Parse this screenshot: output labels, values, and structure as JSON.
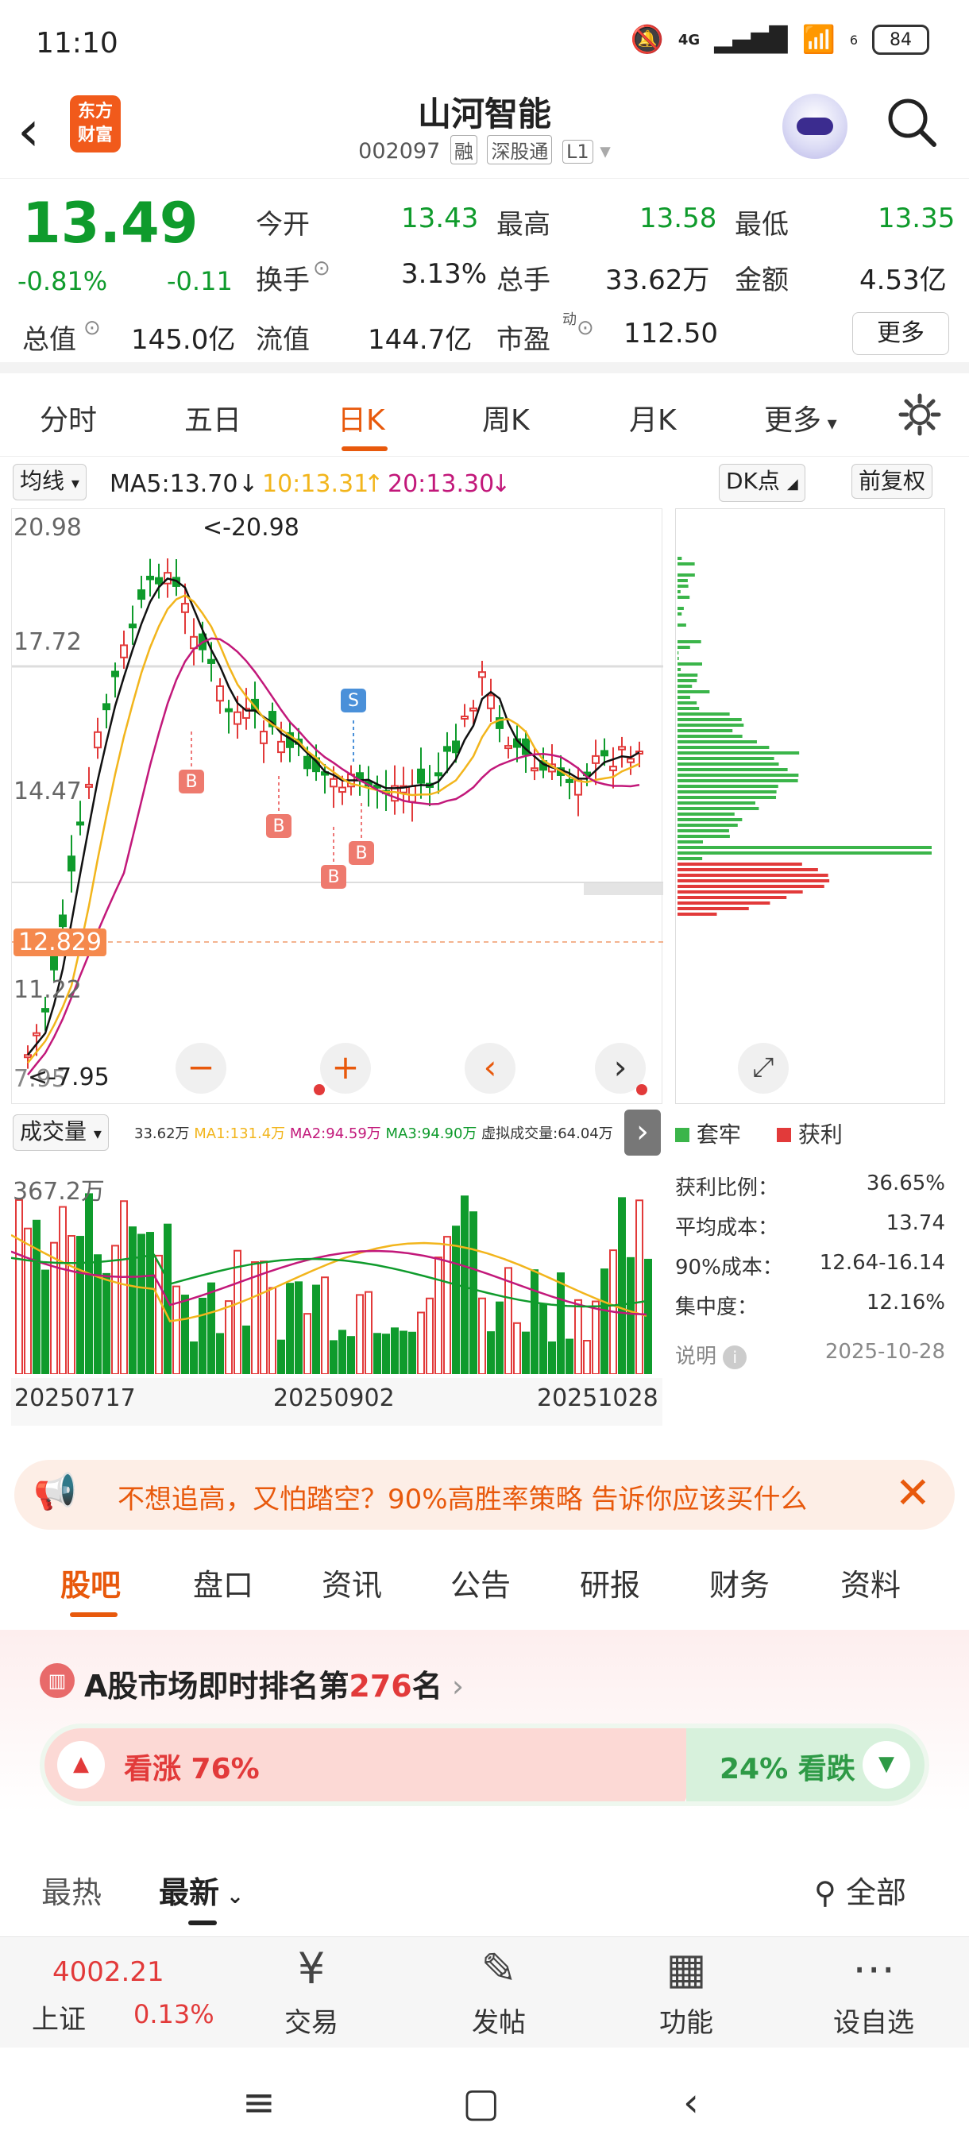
{
  "status_bar": {
    "time": "11:10",
    "network": "4G",
    "wifi_badge": "6",
    "battery": "84"
  },
  "header": {
    "logo_text": "东方财富",
    "stock_name": "山河智能",
    "stock_code": "002097",
    "tags": [
      "融",
      "深股通",
      "L1"
    ]
  },
  "quote": {
    "price": "13.49",
    "change_pct": "-0.81%",
    "change": "-0.11",
    "fields": [
      {
        "label": "今开",
        "value": "13.43",
        "color": "#0f9b2c"
      },
      {
        "label": "最高",
        "value": "13.58",
        "color": "#0f9b2c"
      },
      {
        "label": "最低",
        "value": "13.35",
        "color": "#0f9b2c"
      },
      {
        "label": "换手",
        "value": "3.13%",
        "color": "#222222"
      },
      {
        "label": "总手",
        "value": "33.62万",
        "color": "#222222"
      },
      {
        "label": "金额",
        "value": "4.53亿",
        "color": "#222222"
      },
      {
        "label": "总值",
        "value": "145.0亿",
        "color": "#222222"
      },
      {
        "label": "流值",
        "value": "144.7亿",
        "color": "#222222"
      },
      {
        "label": "市盈",
        "value": "112.50",
        "color": "#222222"
      }
    ],
    "pe_superscript": "动",
    "more_label": "更多"
  },
  "period_tabs": [
    "分时",
    "五日",
    "日K",
    "周K",
    "月K",
    "更多"
  ],
  "active_period": "日K",
  "ma_bar": {
    "selector": "均线",
    "ma5": "MA5:13.70",
    "ma10": "10:13.31",
    "ma20": "20:13.30",
    "dk_label": "DK点",
    "adjust_label": "前复权"
  },
  "kline": {
    "y_labels": [
      "20.98",
      "17.72",
      "14.47",
      "11.22",
      "7.95"
    ],
    "high_annotation": "<-20.98",
    "low_annotation": "<-7.95",
    "current_price_tag": "12.829",
    "markers": [
      "B",
      "B",
      "B",
      "B",
      "S"
    ],
    "colors": {
      "up": "#e23a3a",
      "down": "#0f9b2c",
      "ma5": "#111111",
      "ma10": "#f2b51c",
      "ma20": "#c2187a"
    }
  },
  "volume": {
    "selector": "成交量",
    "legend": [
      "33.62万",
      "MA1:131.4万",
      "MA2:94.59万",
      "MA3:94.90万",
      "虚拟成交量:64.04万"
    ],
    "y_label": "367.2万",
    "dates": [
      "20250717",
      "20250902",
      "20251028"
    ]
  },
  "chip_distribution": {
    "legend_trapped": "套牢",
    "legend_profit": "获利",
    "stats": [
      {
        "label": "获利比例：",
        "value": "36.65%"
      },
      {
        "label": "平均成本：",
        "value": "13.74"
      },
      {
        "label": "90%成本：",
        "value": "12.64-16.14"
      },
      {
        "label": "集中度：",
        "value": "12.16%"
      }
    ],
    "note_label": "说明",
    "date": "2025-10-28"
  },
  "promo_banner": {
    "text": "不想追高，又怕踏空？90%高胜率策略 告诉你应该买什么"
  },
  "bottom_tabs": [
    "股吧",
    "盘口",
    "资讯",
    "公告",
    "研报",
    "财务",
    "资料"
  ],
  "active_bottom_tab": "股吧",
  "ranking": {
    "prefix": "A股市场即时排名第",
    "rank": "276",
    "suffix": "名",
    "up_label": "看涨 76%",
    "down_label": "24% 看跌"
  },
  "feed_tabs": {
    "hot": "最热",
    "new": "最新",
    "filter": "全部"
  },
  "bottom_bar": {
    "index_value": "4002.21",
    "index_name": "上证",
    "index_change": "0.13%",
    "items": [
      "交易",
      "发帖",
      "功能",
      "设自选"
    ]
  }
}
